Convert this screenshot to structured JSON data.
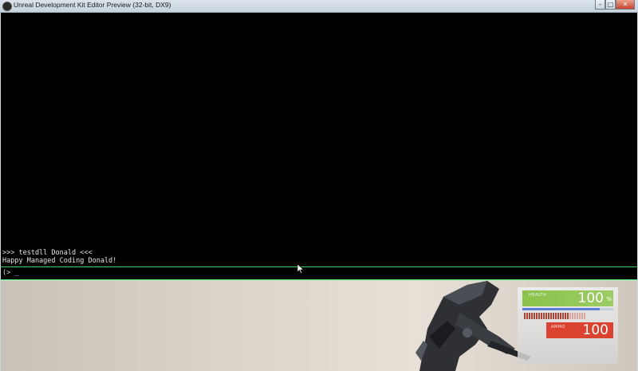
{
  "window": {
    "title": "Unreal Development Kit Editor Preview (32-bit, DX9)",
    "controls": {
      "minimize": "–",
      "maximize": "□",
      "close": "✕"
    }
  },
  "console": {
    "lines": [
      ">>> testdll Donald <<<",
      "Happy Managed Coding Donald!"
    ],
    "prompt": "(> _"
  },
  "hud": {
    "health_label": "HEALTH",
    "health_value": "100",
    "health_unit": "%",
    "ammo_label": "AMMO",
    "ammo_value": "100",
    "shield_fraction": 0.85,
    "colors": {
      "accent_green": "#3bd64a",
      "health": "#8bc34a",
      "ammo": "#d9432f",
      "shield": "#5b7fd6"
    }
  },
  "icons": {
    "app_icon": "unreal-logo-icon",
    "cursor": "mouse-pointer-icon"
  }
}
